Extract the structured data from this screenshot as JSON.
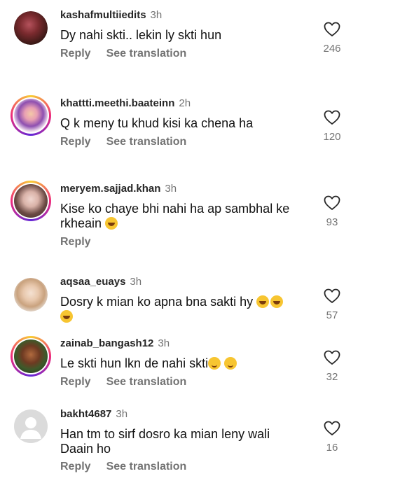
{
  "comments": [
    {
      "username": "kashafmultiiedits",
      "time": "3h",
      "text": "Dy nahi skti.. lekin ly skti hun",
      "reply": "Reply",
      "translate": "See translation",
      "likes": "246"
    },
    {
      "username": "khattti.meethi.baateinn",
      "time": "2h",
      "text": "Q k meny tu khud kisi ka chena ha",
      "reply": "Reply",
      "translate": "See translation",
      "likes": "120"
    },
    {
      "username": "meryem.sajjad.khan",
      "time": "3h",
      "text": "Kise ko chaye bhi nahi ha ap sambhal ke",
      "text2": "rkheain",
      "reply": "Reply",
      "likes": "93"
    },
    {
      "username": "aqsaa_euays",
      "time": "3h",
      "text": "Dosry k mian ko apna bna sakti hy",
      "likes": "57"
    },
    {
      "username": "zainab_bangash12",
      "time": "3h",
      "text": "Le skti hun lkn de nahi skti",
      "reply": "Reply",
      "translate": "See translation",
      "likes": "32"
    },
    {
      "username": "bakht4687",
      "time": "3h",
      "text": "Han tm to sirf dosro ka mian leny wali",
      "text2": "Daain ho",
      "reply": "Reply",
      "translate": "See translation",
      "likes": "16"
    }
  ],
  "icons": {
    "like": "heart-outline-icon",
    "laugh": "laughing-emoji-icon",
    "smile": "smiling-emoji-icon"
  }
}
